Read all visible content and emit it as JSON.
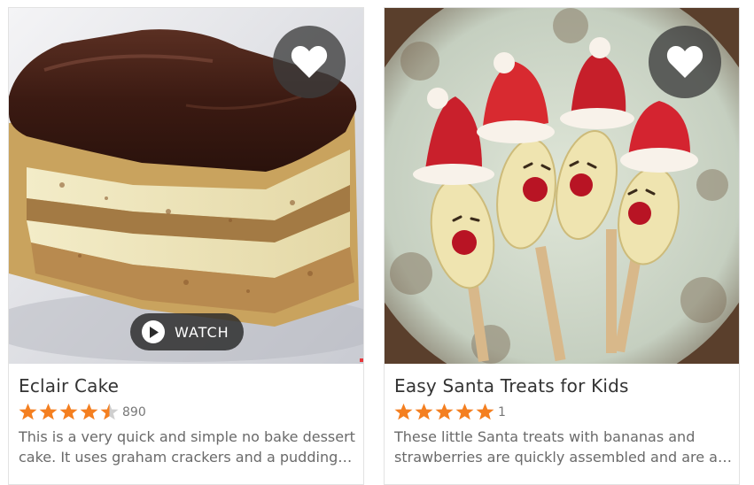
{
  "cards": [
    {
      "title": "Eclair Cake",
      "rating_count": "890",
      "rating": 4.5,
      "watch_label": "WATCH",
      "description_lines": [
        "This is a very quick and simple no bake dessert",
        "cake. It uses graham crackers and a pudding…"
      ],
      "favorite_icon": "heart-icon",
      "play_icon": "play-icon"
    },
    {
      "title": "Easy Santa Treats for Kids",
      "rating_count": "1",
      "rating": 5,
      "description_lines": [
        "These little Santa treats with bananas and",
        "strawberries are quickly assembled and are a…"
      ],
      "favorite_icon": "heart-icon"
    }
  ],
  "colors": {
    "star": "#f47f20",
    "star_empty": "#cfcfcf",
    "title": "#333333",
    "text": "#6a6a6a",
    "overlay": "#3c3c3c"
  }
}
